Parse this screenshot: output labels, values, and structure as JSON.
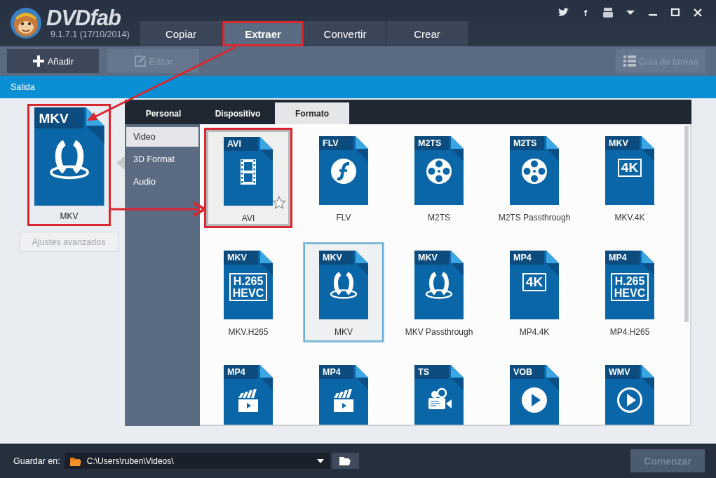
{
  "app": {
    "name": "DVDfab",
    "version": "9.1.7.1 (17/10/2014)",
    "social_letter": "f"
  },
  "modes": [
    {
      "label": "Copiar",
      "selected": false,
      "annotated": false
    },
    {
      "label": "Extraer",
      "selected": true,
      "annotated": true
    },
    {
      "label": "Convertir",
      "selected": false,
      "annotated": false
    },
    {
      "label": "Crear",
      "selected": false,
      "annotated": false
    }
  ],
  "toolbar": {
    "buttons": [
      {
        "label": "Añadir",
        "disabled": false
      },
      {
        "label": "Editar",
        "disabled": true
      }
    ],
    "queue_button": {
      "label": "Cola de tareas",
      "disabled": true
    }
  },
  "output_bar": {
    "label": "Salida"
  },
  "output_preview": {
    "tag": "MKV",
    "kind": "mkv",
    "label": "MKV",
    "annotated": true
  },
  "advanced_button": {
    "label": "Ajustes avanzados",
    "disabled": true
  },
  "profile_tabs": [
    {
      "label": "Personal",
      "selected": false
    },
    {
      "label": "Dispositivo",
      "selected": false
    },
    {
      "label": "Formato",
      "selected": true
    }
  ],
  "categories": [
    {
      "label": "Video",
      "selected": true
    },
    {
      "label": "3D Format",
      "selected": false
    },
    {
      "label": "Audio",
      "selected": false
    }
  ],
  "formats": [
    {
      "tag": "AVI",
      "kind": "film",
      "label": "AVI",
      "selected": false,
      "hovered": true,
      "annotated": true
    },
    {
      "tag": "FLV",
      "kind": "flash",
      "label": "FLV",
      "selected": false,
      "hovered": false,
      "annotated": false
    },
    {
      "tag": "M2TS",
      "kind": "reel",
      "label": "M2TS",
      "selected": false,
      "hovered": false,
      "annotated": false
    },
    {
      "tag": "M2TS",
      "kind": "reel",
      "label": "M2TS Passthrough",
      "selected": false,
      "hovered": false,
      "annotated": false
    },
    {
      "tag": "MKV",
      "kind": "text",
      "lines": [
        "4K"
      ],
      "label": "MKV.4K",
      "selected": false,
      "hovered": false,
      "annotated": false
    },
    {
      "tag": "MKV",
      "kind": "text",
      "lines": [
        "H.265",
        "HEVC"
      ],
      "label": "MKV.H265",
      "selected": false,
      "hovered": false,
      "annotated": false
    },
    {
      "tag": "MKV",
      "kind": "mkv",
      "label": "MKV",
      "selected": true,
      "hovered": false,
      "annotated": false
    },
    {
      "tag": "MKV",
      "kind": "mkv",
      "label": "MKV Passthrough",
      "selected": false,
      "hovered": false,
      "annotated": false
    },
    {
      "tag": "MP4",
      "kind": "text",
      "lines": [
        "4K"
      ],
      "label": "MP4.4K",
      "selected": false,
      "hovered": false,
      "annotated": false
    },
    {
      "tag": "MP4",
      "kind": "text",
      "lines": [
        "H.265",
        "HEVC"
      ],
      "label": "MP4.H265",
      "selected": false,
      "hovered": false,
      "annotated": false
    },
    {
      "tag": "MP4",
      "kind": "clapper",
      "selected": false,
      "hovered": false,
      "annotated": false
    },
    {
      "tag": "MP4",
      "kind": "clapper",
      "selected": false,
      "hovered": false,
      "annotated": false
    },
    {
      "tag": "TS",
      "kind": "camera",
      "selected": false,
      "hovered": false,
      "annotated": false
    },
    {
      "tag": "VOB",
      "kind": "play",
      "selected": false,
      "hovered": false,
      "annotated": false
    },
    {
      "tag": "WMV",
      "kind": "playring",
      "selected": false,
      "hovered": false,
      "annotated": false
    }
  ],
  "footer": {
    "save_label": "Guardar en:",
    "path": "C:\\Users\\ruben\\Videos\\",
    "start_button": {
      "label": "Comenzar",
      "disabled": true
    }
  }
}
